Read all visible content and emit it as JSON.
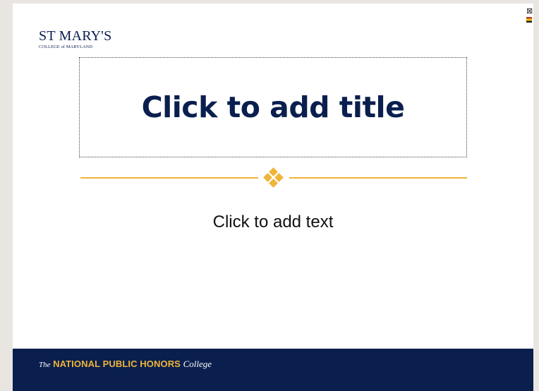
{
  "logo": {
    "name_prefix": "ST",
    "name_main": "MARY'S",
    "subtitle": "COLLEGE of MARYLAND"
  },
  "placeholders": {
    "title": "Click to add title",
    "text": "Click to add text"
  },
  "footer": {
    "prefix": "The",
    "name": "NATIONAL PUBLIC HONORS",
    "suffix": "College"
  },
  "colors": {
    "navy": "#0a1f4e",
    "gold": "#f0b43a"
  },
  "icons": [
    "close-icon",
    "flag-icon"
  ]
}
